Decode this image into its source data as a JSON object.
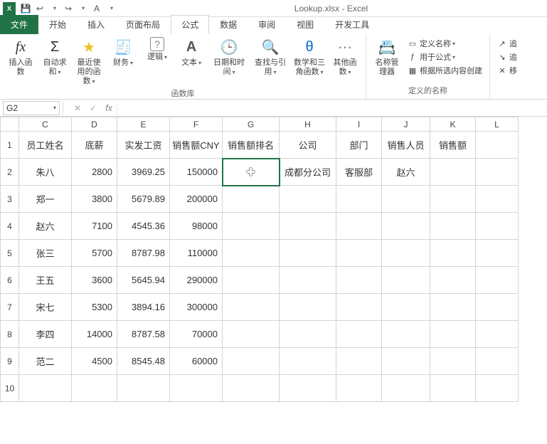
{
  "app": {
    "icon_text": "X",
    "title": "Lookup.xlsx - Excel"
  },
  "qat": {
    "save": "💾",
    "undo": "↩",
    "redo": "↪",
    "more": "▾",
    "touch": "A"
  },
  "tabs": {
    "file": "文件",
    "home": "开始",
    "insert": "插入",
    "layout": "页面布局",
    "formulas": "公式",
    "data": "数据",
    "review": "审阅",
    "view": "视图",
    "dev": "开发工具"
  },
  "ribbon": {
    "insert_fn": {
      "label": "插入函数",
      "icon": "fx"
    },
    "autosum": {
      "label": "自动求和",
      "icon": "Σ"
    },
    "recent": {
      "label": "最近使用的函数",
      "icon": "★"
    },
    "financial": {
      "label": "财务",
      "icon": "🧾"
    },
    "logical": {
      "label": "逻辑",
      "icon": "?"
    },
    "text": {
      "label": "文本",
      "icon": "A"
    },
    "datetime": {
      "label": "日期和时间",
      "icon": "🕒"
    },
    "lookup": {
      "label": "查找与引用",
      "icon": "🔍"
    },
    "math": {
      "label": "数学和三角函数",
      "icon": "θ"
    },
    "more": {
      "label": "其他函数",
      "icon": "⋯"
    },
    "lib_label": "函数库",
    "name_mgr": {
      "label": "名称管理器",
      "icon": "📇"
    },
    "define_name": "定义名称",
    "use_in_formula": "用于公式",
    "create_from_sel": "根据所选内容创建",
    "names_label": "定义的名称",
    "trace": "追",
    "move": "移"
  },
  "formula_bar": {
    "cell_ref": "G2",
    "cancel": "✕",
    "enter": "✓",
    "fx": "fx",
    "value": ""
  },
  "columns": [
    "",
    "C",
    "D",
    "E",
    "F",
    "G",
    "H",
    "I",
    "J",
    "K",
    "L"
  ],
  "headers": {
    "C": "员工姓名",
    "D": "底薪",
    "E": "实发工资",
    "F": "销售额CNY",
    "G": "销售额排名",
    "H": "公司",
    "I": "部门",
    "J": "销售人员",
    "K": "销售额"
  },
  "rows": [
    {
      "n": "1"
    },
    {
      "n": "2",
      "C": "朱八",
      "D": "2800",
      "E": "3969.25",
      "F": "150000",
      "G": "",
      "H": "成都分公司",
      "I": "客服部",
      "J": "赵六",
      "K": ""
    },
    {
      "n": "3",
      "C": "郑一",
      "D": "3800",
      "E": "5679.89",
      "F": "200000"
    },
    {
      "n": "4",
      "C": "赵六",
      "D": "7100",
      "E": "4545.36",
      "F": "98000"
    },
    {
      "n": "5",
      "C": "张三",
      "D": "5700",
      "E": "8787.98",
      "F": "110000"
    },
    {
      "n": "6",
      "C": "王五",
      "D": "3600",
      "E": "5645.94",
      "F": "290000"
    },
    {
      "n": "7",
      "C": "宋七",
      "D": "5300",
      "E": "3894.16",
      "F": "300000"
    },
    {
      "n": "8",
      "C": "李四",
      "D": "14000",
      "E": "8787.58",
      "F": "70000"
    },
    {
      "n": "9",
      "C": "范二",
      "D": "4500",
      "E": "8545.48",
      "F": "60000"
    },
    {
      "n": "10"
    }
  ],
  "selected": "G2"
}
